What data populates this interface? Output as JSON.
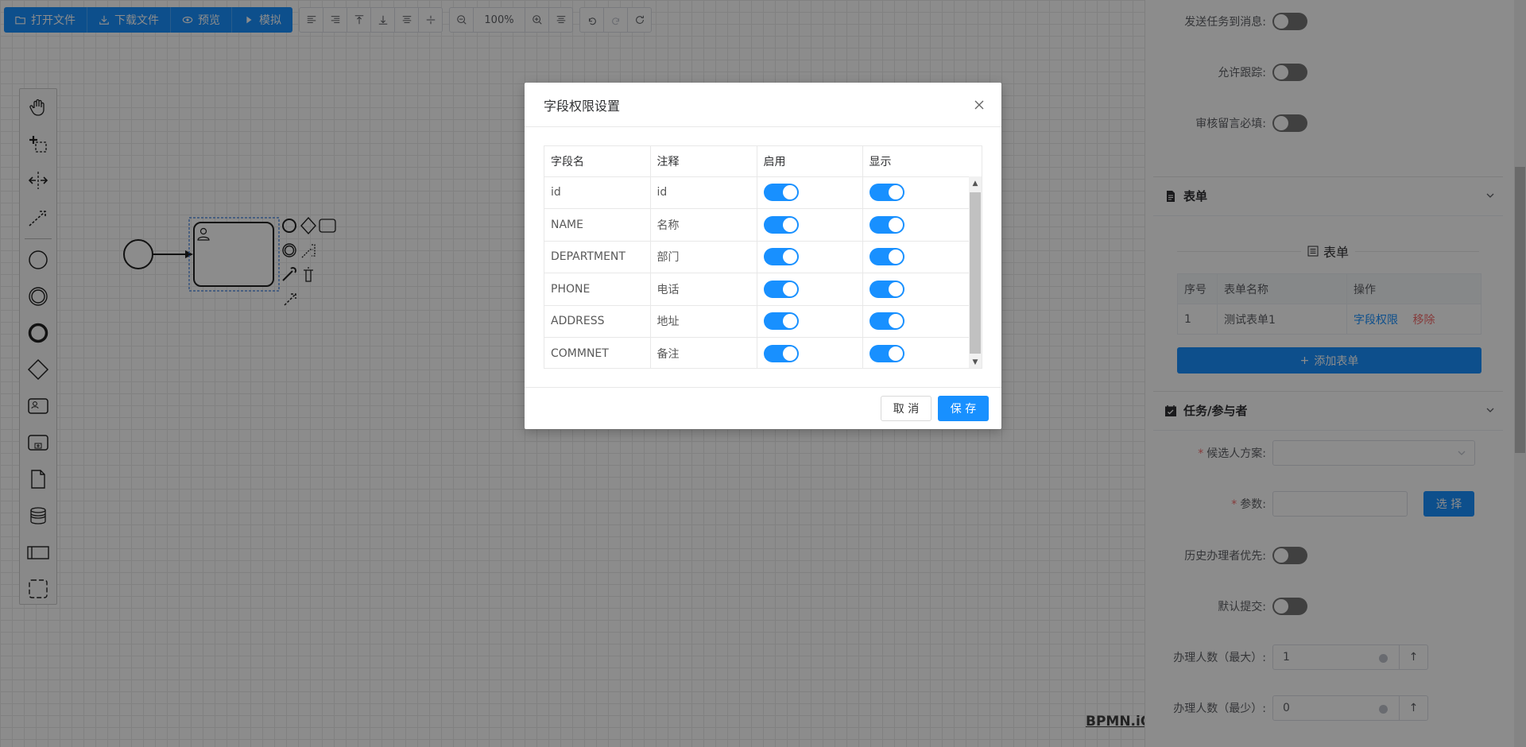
{
  "toolbar": {
    "open_file": "打开文件",
    "download_file": "下载文件",
    "preview": "预览",
    "simulate": "模拟",
    "zoom": "100%"
  },
  "palette": {
    "items": [
      "hand-tool",
      "lasso-tool",
      "space-tool",
      "global-connect-tool",
      "start-event",
      "intermediate-event",
      "end-event",
      "gateway",
      "user-task",
      "subprocess",
      "data-object",
      "data-store",
      "pool",
      "group"
    ]
  },
  "logo": "BPMN.iO",
  "panel": {
    "send_task_msg": "发送任务到消息:",
    "allow_trace": "允许跟踪:",
    "audit_comment_required": "审核留言必填:",
    "form_section": "表单",
    "form_subtitle": "表单",
    "form_table": {
      "headers": [
        "序号",
        "表单名称",
        "操作"
      ],
      "rows": [
        {
          "index": "1",
          "name": "测试表单1",
          "perm": "字段权限",
          "remove": "移除"
        }
      ]
    },
    "add_form": "添加表单",
    "task_section": "任务/参与者",
    "candidate_plan": "候选人方案:",
    "param": "参数:",
    "choose": "选 择",
    "history_first": "历史办理者优先:",
    "default_submit": "默认提交:",
    "max_handlers": "办理人数（最大）:",
    "max_handlers_value": "1",
    "min_handlers": "办理人数（最少）:",
    "min_handlers_value": "0"
  },
  "dialog": {
    "title": "字段权限设置",
    "headers": [
      "字段名",
      "注释",
      "启用",
      "显示"
    ],
    "rows": [
      {
        "field": "id",
        "comment": "id",
        "enabled": true,
        "visible": true
      },
      {
        "field": "NAME",
        "comment": "名称",
        "enabled": true,
        "visible": true
      },
      {
        "field": "DEPARTMENT",
        "comment": "部门",
        "enabled": true,
        "visible": true
      },
      {
        "field": "PHONE",
        "comment": "电话",
        "enabled": true,
        "visible": true
      },
      {
        "field": "ADDRESS",
        "comment": "地址",
        "enabled": true,
        "visible": true
      },
      {
        "field": "COMMNET",
        "comment": "备注",
        "enabled": true,
        "visible": true
      }
    ],
    "cancel": "取 消",
    "save": "保 存"
  },
  "colors": {
    "primary": "#1890ff",
    "danger": "#f56c6c"
  }
}
